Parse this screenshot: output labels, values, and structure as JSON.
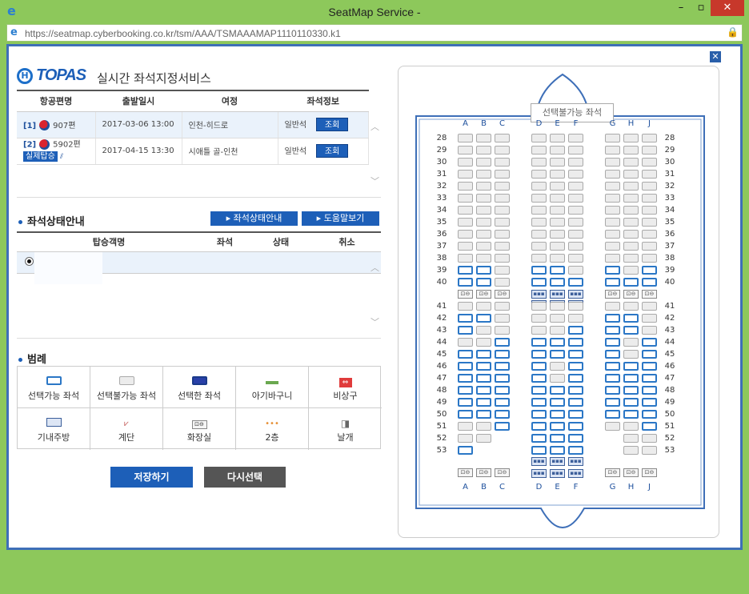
{
  "window": {
    "title": "SeatMap Service -",
    "url": "https://seatmap.cyberbooking.co.kr/tsm/AAA/TSMAAAMAP1110110330.k1"
  },
  "brand": {
    "logo": "TOPAS",
    "service": "실시간 좌석지정서비스"
  },
  "flights": {
    "headers": [
      "항공편명",
      "출발일시",
      "여정",
      "좌석정보"
    ],
    "rows": [
      {
        "idx": "[1]",
        "flight": "907편",
        "date": "2017-03-06 13:00",
        "route": "인천-히드로",
        "class": "일반석",
        "btn": "조회"
      },
      {
        "idx": "[2]",
        "flight": "5902편",
        "badge": "실제탑승",
        "date": "2017-04-15 13:30",
        "route": "시애틀 골-인천",
        "class": "일반석",
        "btn": "조회"
      }
    ]
  },
  "seat_status": {
    "title": "좌석상태안내",
    "btn_status": "좌석상태안내",
    "btn_help": "도움말보기",
    "headers": [
      "탑승객명",
      "좌석",
      "상태",
      "취소"
    ]
  },
  "legend": {
    "title": "범례",
    "items": [
      {
        "label": "선택가능 좌석",
        "icon": "seat-available-icon"
      },
      {
        "label": "선택불가능 좌석",
        "icon": "seat-unavailable-icon"
      },
      {
        "label": "선택한 좌석",
        "icon": "seat-selected-icon"
      },
      {
        "label": "아기바구니",
        "icon": "bassinet-icon"
      },
      {
        "label": "비상구",
        "icon": "exit-icon"
      },
      {
        "label": "기내주방",
        "icon": "galley-icon"
      },
      {
        "label": "계단",
        "icon": "stairs-icon"
      },
      {
        "label": "화장실",
        "icon": "lavatory-icon"
      },
      {
        "label": "2층",
        "icon": "upper-deck-icon"
      },
      {
        "label": "날개",
        "icon": "wing-icon"
      }
    ]
  },
  "actions": {
    "save": "저장하기",
    "reselect": "다시선택"
  },
  "seatmap": {
    "tooltip": "선택불가능 좌석",
    "columns": [
      "A",
      "B",
      "C",
      "D",
      "E",
      "F",
      "G",
      "H",
      "J"
    ],
    "rows": [
      "28",
      "29",
      "30",
      "31",
      "32",
      "33",
      "34",
      "35",
      "36",
      "37",
      "38",
      "39",
      "40",
      "41",
      "42",
      "43",
      "44",
      "45",
      "46",
      "47",
      "48",
      "49",
      "50",
      "51",
      "52",
      "53"
    ]
  }
}
